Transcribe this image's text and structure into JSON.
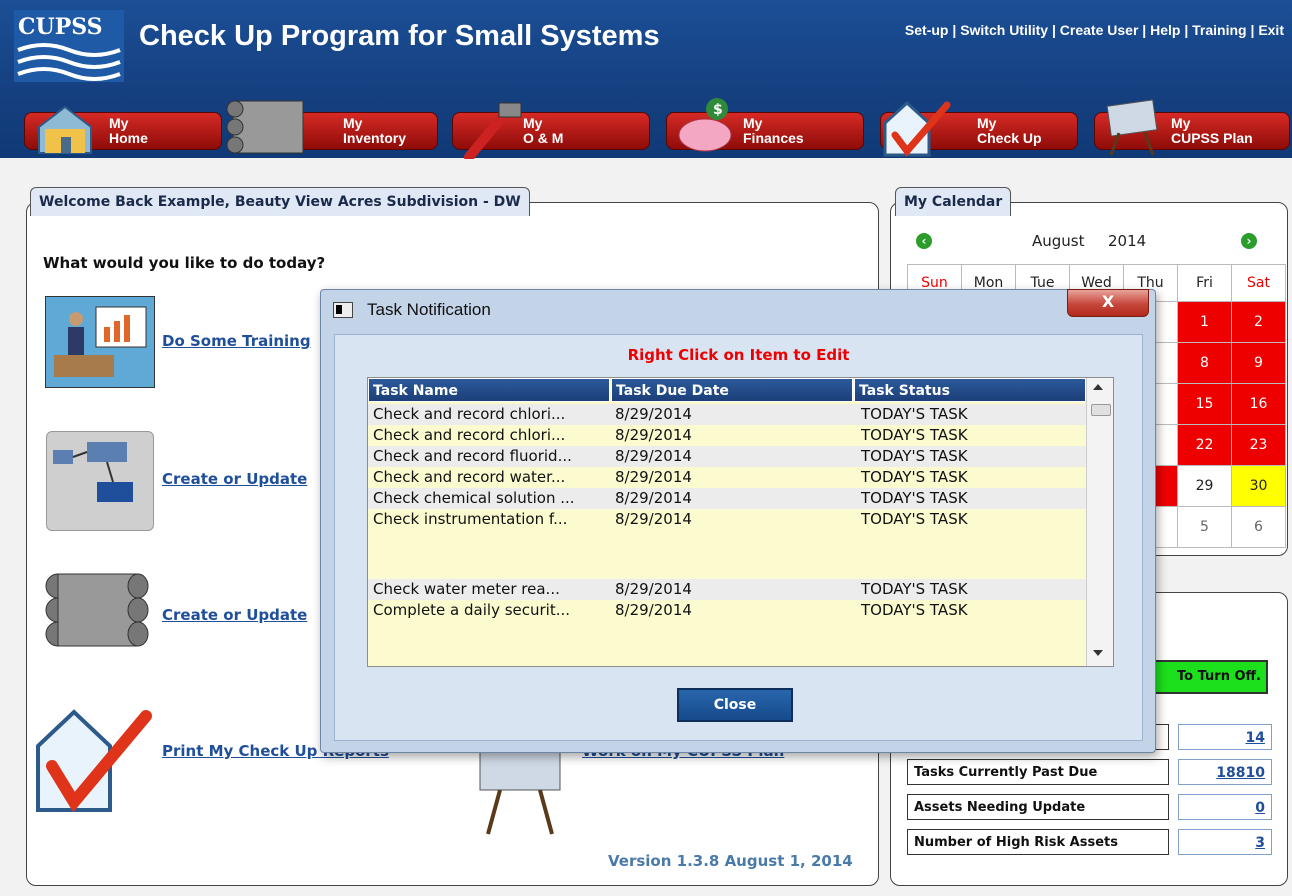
{
  "header": {
    "logo_text": "CUPSS",
    "title": "Check Up Program for Small Systems",
    "links": [
      "Set-up",
      "Switch Utility",
      "Create User",
      "Help",
      "Training",
      "Exit"
    ],
    "link_separator": " | "
  },
  "nav": [
    {
      "line1": "My",
      "line2": "Home",
      "icon": "house-icon"
    },
    {
      "line1": "My",
      "line2": "Inventory",
      "icon": "pipes-icon"
    },
    {
      "line1": "My",
      "line2": "O & M",
      "icon": "pipe-wrench-icon"
    },
    {
      "line1": "My",
      "line2": "Finances",
      "icon": "piggy-bank-icon"
    },
    {
      "line1": "My",
      "line2": "Check Up",
      "icon": "house-checkmark-icon"
    },
    {
      "line1": "My",
      "line2": "CUPSS Plan",
      "icon": "plan-easel-icon"
    }
  ],
  "welcome": {
    "tab_label": "Welcome Back Example, Beauty View Acres Subdivision - DW",
    "question": "What would you like to do today?",
    "actions": [
      {
        "label": "Do Some Training",
        "icon": "training-presentation-icon"
      },
      {
        "label": "Create or Update",
        "icon": "system-diagram-icon"
      },
      {
        "label": "Create or Update",
        "icon": "pipes-icon"
      },
      {
        "label": "Print My Check Up Reports",
        "icon": "house-checkmark-icon"
      },
      {
        "label": "Work on My CUPSS Plan",
        "icon": "plan-easel-icon"
      }
    ],
    "version": "Version 1.3.8 August 1, 2014"
  },
  "calendar": {
    "tab_label": "My Calendar",
    "month": "August",
    "year": "2014",
    "days": [
      "Sun",
      "Mon",
      "Tue",
      "Wed",
      "Thu",
      "Fri",
      "Sat"
    ],
    "visible_cells": [
      [
        "1",
        "2"
      ],
      [
        "8",
        "9"
      ],
      [
        "15",
        "16"
      ],
      [
        "22",
        "23"
      ],
      [
        "29",
        "30"
      ],
      [
        "5",
        "6"
      ]
    ],
    "colors": {
      "past_due": "#ee0000",
      "today": "#ffff00"
    }
  },
  "stats": {
    "toggle_label": "To Turn Off.",
    "rows": [
      {
        "label": "",
        "value": "14"
      },
      {
        "label": "Tasks Currently Past Due",
        "value": "18810"
      },
      {
        "label": "Assets Needing Update",
        "value": "0"
      },
      {
        "label": "Number of High Risk Assets",
        "value": "3"
      }
    ]
  },
  "dialog": {
    "title": "Task Notification",
    "close_x": "X",
    "hint": "Right Click on Item to Edit",
    "columns": [
      "Task Name",
      "Task Due Date",
      "Task Status"
    ],
    "rows": [
      [
        "Check and record chlori...",
        "8/29/2014",
        "TODAY'S TASK"
      ],
      [
        "Check and record chlori...",
        "8/29/2014",
        "TODAY'S TASK"
      ],
      [
        "Check and record fluorid...",
        "8/29/2014",
        "TODAY'S TASK"
      ],
      [
        "Check and record water...",
        "8/29/2014",
        "TODAY'S TASK"
      ],
      [
        "Check chemical solution ...",
        "8/29/2014",
        "TODAY'S TASK"
      ],
      [
        "Check instrumentation f...",
        "8/29/2014",
        "TODAY'S TASK"
      ],
      [
        "Check water meter rea...",
        "8/29/2014",
        "TODAY'S TASK"
      ],
      [
        "Complete a daily securit...",
        "8/29/2014",
        "TODAY'S TASK"
      ]
    ],
    "close_label": "Close"
  }
}
